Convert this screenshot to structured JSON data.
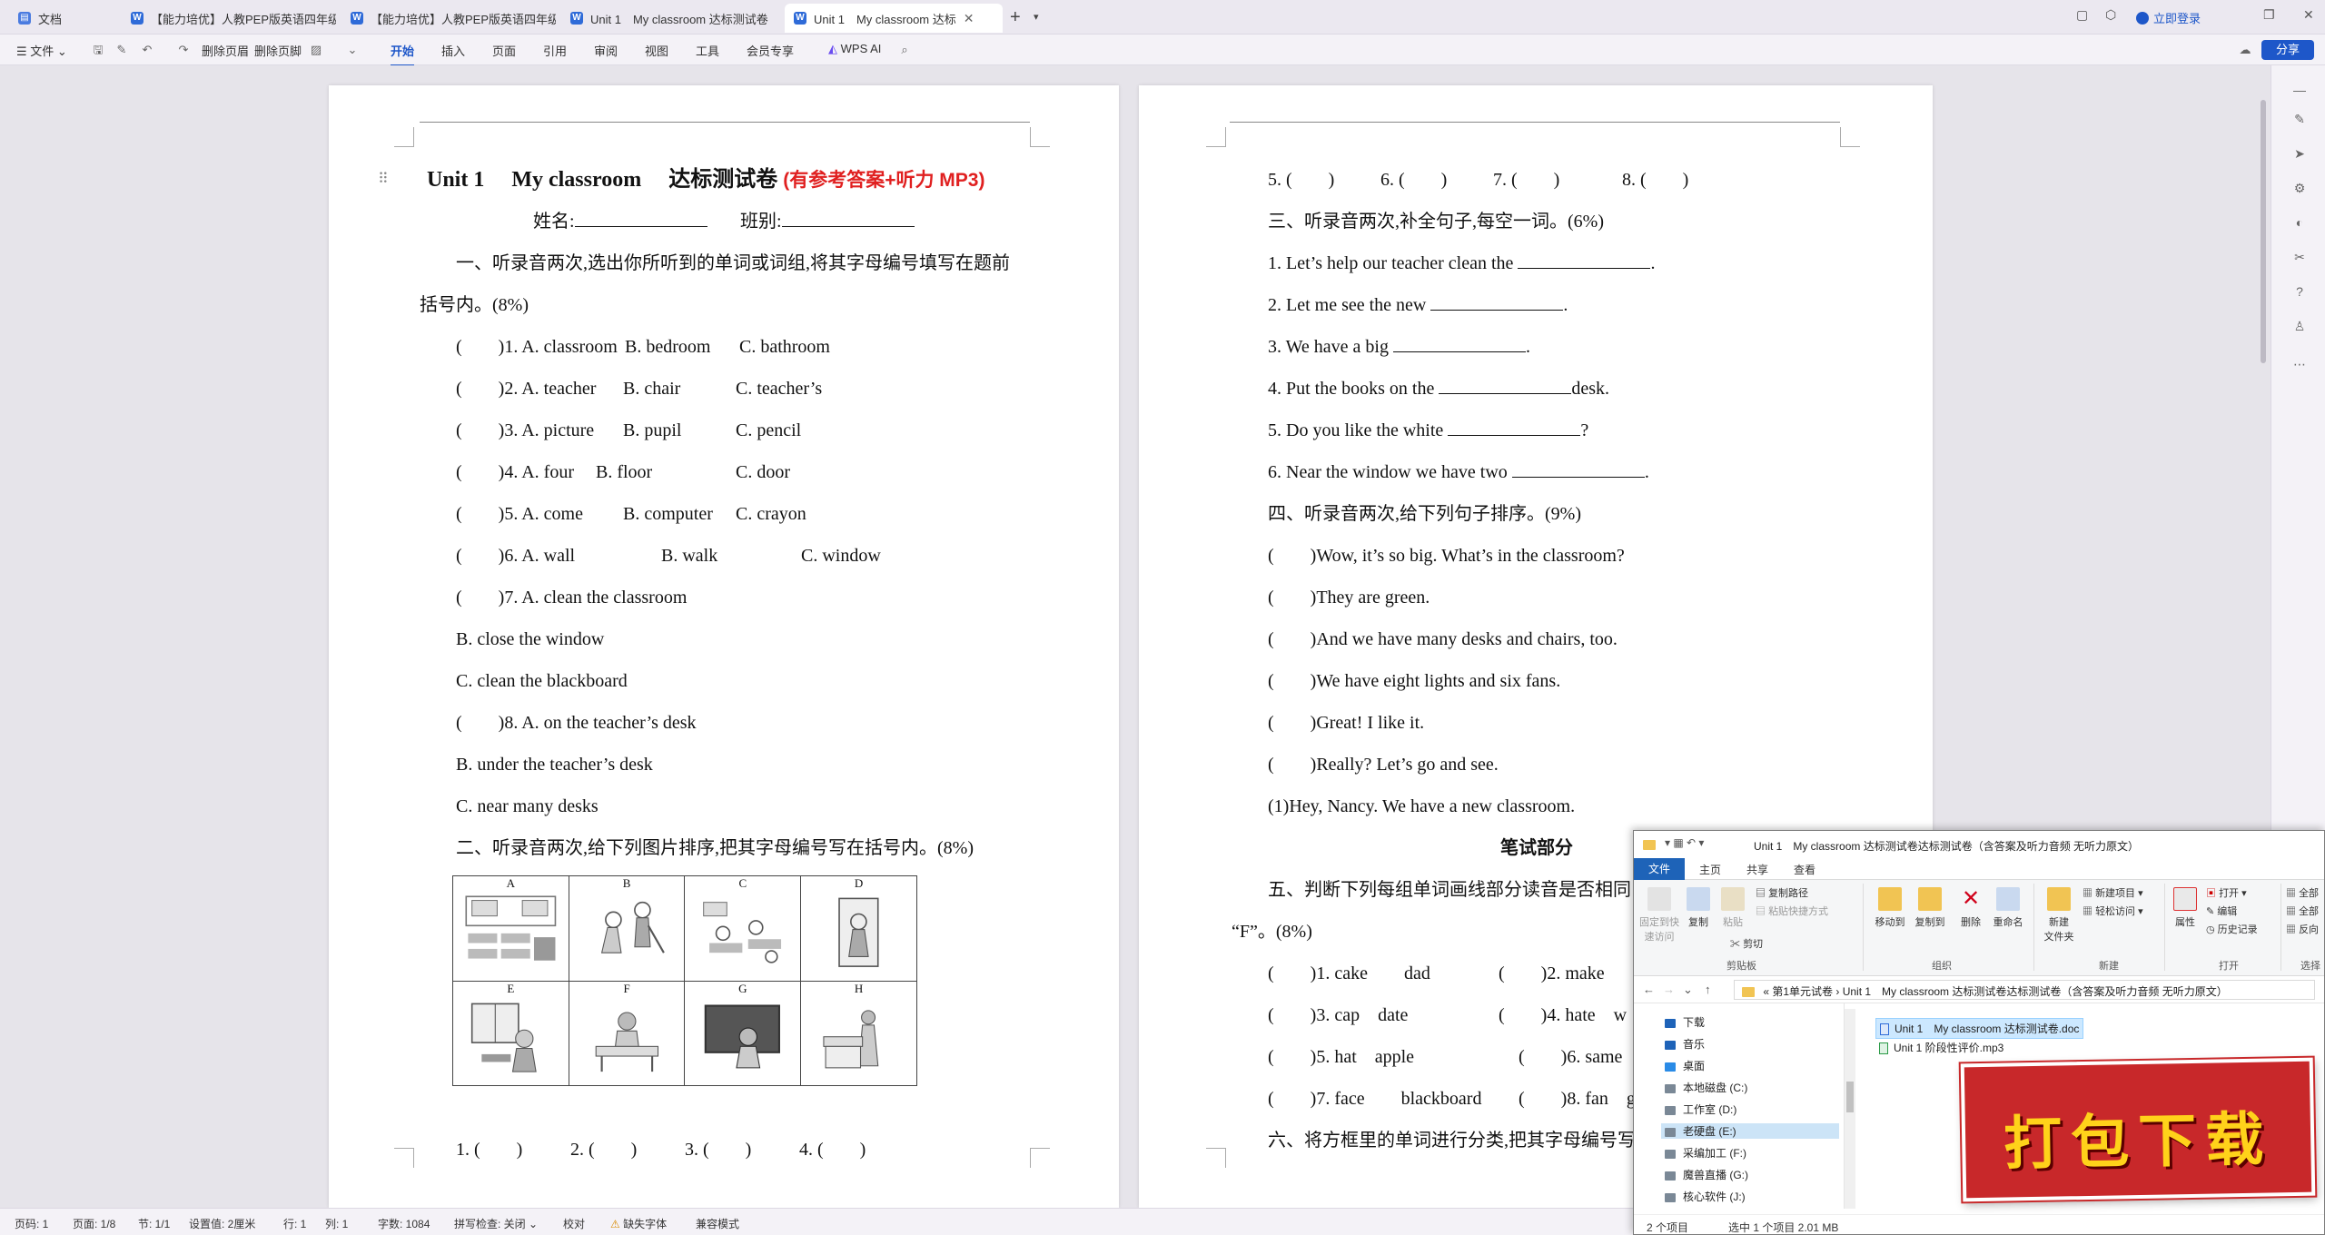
{
  "tabs": {
    "home": "文档",
    "items": [
      {
        "label": "【能力培优】人教PEP版英语四年级上"
      },
      {
        "label": "【能力培优】人教PEP版英语四年级上"
      },
      {
        "label": "Unit 1　My classroom 达标测试卷"
      },
      {
        "label": "Unit 1　My classroom 达标"
      }
    ],
    "login": "立即登录"
  },
  "menubar": {
    "file": "文件",
    "delete_header": "删除页眉",
    "delete_footer": "删除页脚",
    "tabs": [
      "开始",
      "插入",
      "页面",
      "引用",
      "审阅",
      "视图",
      "工具",
      "会员专享"
    ],
    "wps_ai": "WPS AI",
    "share": "分享"
  },
  "page1": {
    "title_main": "Unit 1　 My classroom　 达标测试卷",
    "title_note": "(有参考答案+听力 MP3)",
    "name_line": "姓名:",
    "class_line": "班别:",
    "s1_heading_a": "一、听录音两次,选出你所听到的单词或词组,将其字母编号填写在题前",
    "s1_heading_b": "括号内。(8%)",
    "q1": {
      "stem": "(　　)1. A. classroom",
      "b": "B. bedroom",
      "c": "C. bathroom"
    },
    "q2": {
      "stem": "(　　)2. A. teacher",
      "b": "B. chair",
      "c": "C. teacher’s"
    },
    "q3": {
      "stem": "(　　)3. A. picture",
      "b": "B. pupil",
      "c": "C. pencil"
    },
    "q4": {
      "stem": "(　　)4. A. four",
      "b": "B. floor",
      "c": "C. door"
    },
    "q5": {
      "stem": "(　　)5. A. come",
      "b": "B. computer",
      "c": "C. crayon"
    },
    "q6": {
      "stem": "(　　)6. A. wall",
      "b": "B. walk",
      "c": "C. window"
    },
    "q7": {
      "stem": "(　　)7. A. clean the classroom",
      "b": "B. close the window",
      "c": "C. clean the blackboard"
    },
    "q8": {
      "stem": "(　　)8. A. on the teacher’s desk",
      "b": "B. under the teacher’s desk",
      "c": "C. near many desks"
    },
    "s2_heading": "二、听录音两次,给下列图片排序,把其字母编号写在括号内。(8%)",
    "picture_labels": [
      "A",
      "B",
      "C",
      "D",
      "E",
      "F",
      "G",
      "H"
    ],
    "answers": [
      "1. (　　)",
      "2. (　　)",
      "3. (　　)",
      "4. (　　)"
    ]
  },
  "page2": {
    "answers_top": [
      "5. (　　)",
      "6. (　　)",
      "7. (　　)",
      "8. (　　)"
    ],
    "s3_heading": "三、听录音两次,补全句子,每空一词。(6%)",
    "s3_items": [
      "1. Let’s help our teacher clean the",
      "2. Let me see the new",
      "3. We have a big",
      "4. Put the books on the",
      "5. Do you like the white",
      "6. Near the window we have two"
    ],
    "s3_item4_end": "desk.",
    "s3_item5_end": "?",
    "period": ".",
    "s4_heading": "四、听录音两次,给下列句子排序。(9%)",
    "s4_items": [
      "(　　)Wow, it’s so big. What’s in the classroom?",
      "(　　)They are green.",
      "(　　)And we have many desks and chairs, too.",
      "(　　)We have eight lights and six fans.",
      "(　　)Great! I like it.",
      "(　　)Really? Let’s go and see."
    ],
    "s4_first": "(1)Hey, Nancy. We have a new classroom.",
    "written_heading": "笔试部分",
    "s5_heading_a": "五、判断下列每组单词画线部分读音是否相同",
    "s5_heading_b": "“F”。(8%)",
    "s5_rows": [
      {
        "a": "(　　)1. cake　　dad",
        "b": "(　　)2. make"
      },
      {
        "a": "(　　)3. cap　date",
        "b": "(　　)4. hate　w"
      },
      {
        "a": "(　　)5. hat　apple",
        "b": "(　　)6. same"
      },
      {
        "a": "(　　)7. face　　blackboard",
        "b": "(　　)8. fan　g"
      }
    ],
    "s6_heading": "六、将方框里的单词进行分类,把其字母编号写"
  },
  "statusbar": {
    "page": "页码: 1",
    "pages": "页面: 1/8",
    "section": "节: 1/1",
    "setting": "设置值: 2厘米",
    "row": "行: 1",
    "col": "列: 1",
    "words": "字数: 1084",
    "spell": "拼写检查: 关闭",
    "proof": "校对",
    "missing_font": "缺失字体",
    "compat": "兼容模式"
  },
  "explorer": {
    "title": "Unit 1　My classroom 达标测试卷达标测试卷（含答案及听力音频 无听力原文）",
    "tabs": [
      "文件",
      "主页",
      "共享",
      "查看"
    ],
    "ribbon": {
      "pin": "固定到快\n速访问",
      "copy": "复制",
      "paste": "粘贴",
      "copy_path": "复制路径",
      "paste_shortcut": "粘贴快捷方式",
      "cut": "剪切",
      "clipboard": "剪贴板",
      "move_to": "移动到",
      "copy_to": "复制到",
      "delete": "删除",
      "rename": "重命名",
      "organize": "组织",
      "new_folder": "新建\n文件夹",
      "new_item": "新建项目",
      "easy_access": "轻松访问",
      "new": "新建",
      "properties": "属性",
      "open": "打开",
      "edit": "编辑",
      "history": "历史记录",
      "open_group": "打开",
      "select_all": "全部",
      "select_none": "全部",
      "invert": "反向",
      "select_group": "选择"
    },
    "address": "« 第1单元试卷 › Unit 1　My classroom 达标测试卷达标测试卷（含答案及听力音频 无听力原文）",
    "nav": [
      "下载",
      "音乐",
      "桌面",
      "本地磁盘 (C:)",
      "工作室 (D:)",
      "老硬盘 (E:)",
      "采编加工 (F:)",
      "魔兽直播 (G:)",
      "核心软件 (J:)"
    ],
    "files": [
      "Unit 1　My classroom 达标测试卷.doc",
      "Unit 1 阶段性评价.mp3"
    ],
    "status_count": "2 个项目",
    "status_selected": "选中 1 个项目  2.01 MB"
  },
  "banner": {
    "text": "打包下载"
  }
}
